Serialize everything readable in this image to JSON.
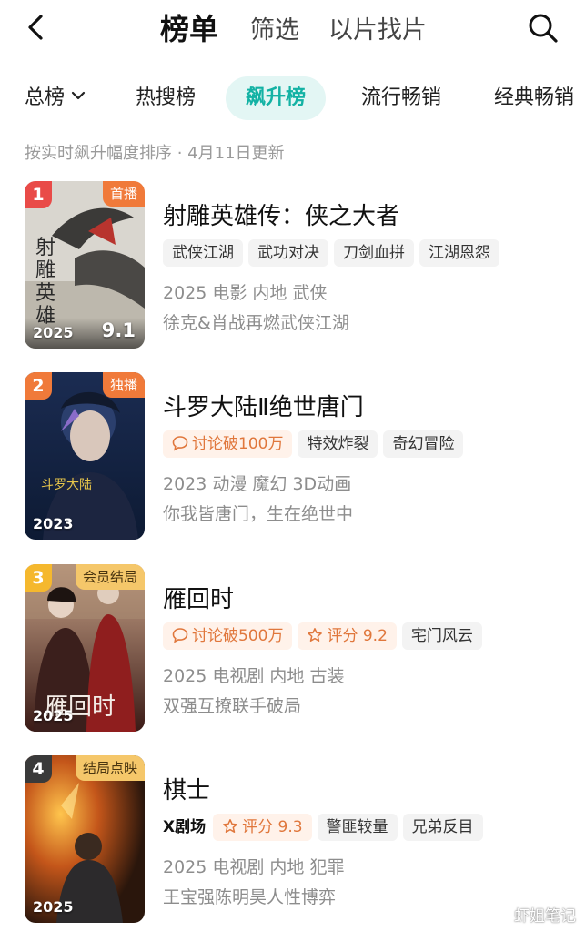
{
  "header": {
    "tabs": [
      {
        "label": "榜单",
        "active": true
      },
      {
        "label": "筛选",
        "active": false
      },
      {
        "label": "以片找片",
        "active": false
      }
    ],
    "back_icon": "chevron-left-icon",
    "search_icon": "search-icon"
  },
  "rank_tabs": [
    {
      "label": "总榜",
      "active": false,
      "has_dropdown": true
    },
    {
      "label": "热搜榜",
      "active": false
    },
    {
      "label": "飙升榜",
      "active": true
    },
    {
      "label": "流行畅销",
      "active": false
    },
    {
      "label": "经典畅销",
      "active": false
    }
  ],
  "subtitle": "按实时飙升幅度排序 · 4月11日更新",
  "accent_color": "#13b2a4",
  "items": [
    {
      "rank": "1",
      "rank_color": "#e94b48",
      "corner_label": "首播",
      "corner_color": "#f07a3a",
      "year": "2025",
      "poster_score": "9.1",
      "title": "射雕英雄传：侠之大者",
      "tags": [
        "武侠江湖",
        "武功对决",
        "刀剑血拼",
        "江湖恩怨"
      ],
      "meta": "2025 电影 内地 武侠",
      "desc": "徐克&肖战再燃武侠江湖"
    },
    {
      "rank": "2",
      "rank_color": "#f07a3a",
      "corner_label": "独播",
      "corner_color": "#f07a3a",
      "year": "2023",
      "title": "斗罗大陆Ⅱ绝世唐门",
      "hot_tag": "讨论破100万",
      "tags": [
        "特效炸裂",
        "奇幻冒险"
      ],
      "meta": "2023 动漫 魔幻 3D动画",
      "desc": "你我皆唐门，生在绝世中"
    },
    {
      "rank": "3",
      "rank_color": "#f5b82e",
      "corner_label": "会员结局",
      "corner_color": "#f5c76a",
      "year": "2025",
      "title": "雁回时",
      "hot_tag": "讨论破500万",
      "score_tag": "评分 9.2",
      "tags": [
        "宅门风云"
      ],
      "meta": "2025 电视剧 内地 古装",
      "desc": "双强互撩联手破局"
    },
    {
      "rank": "4",
      "rank_color": "#3a3a3a",
      "corner_label": "结局点映",
      "corner_color": "#f5c76a",
      "year": "2025",
      "title": "棋士",
      "brand_tag": "X剧场",
      "score_tag": "评分 9.3",
      "tags": [
        "警匪较量",
        "兄弟反目"
      ],
      "meta": "2025 电视剧 内地 犯罪",
      "desc": "王宝强陈明昊人性博弈"
    }
  ],
  "watermark": "虾姐笔记"
}
